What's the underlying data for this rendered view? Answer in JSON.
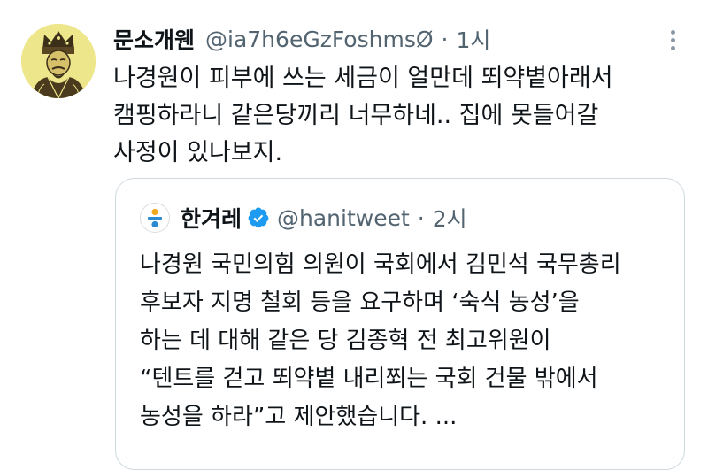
{
  "tweet": {
    "display_name": "문소개웬",
    "handle": "@ia7h6eGzFoshmsØ",
    "separator": "·",
    "time": "1시",
    "more_icon": "more-options-icon",
    "avatar_icon": "king-portrait-avatar",
    "text_lines": [
      "나경원이 피부에 쓰는 세금이 얼만데 뙤약볕아래서",
      "캠핑하라니 같은당끼리 너무하네.. 집에 못들어갈",
      "사정이 있나보지."
    ]
  },
  "quote": {
    "display_name": "한겨레",
    "handle": "@hanitweet",
    "separator": "·",
    "time": "2시",
    "verified_icon": "verified-badge-icon",
    "verified_color": "#1d9bf0",
    "logo_icon": "hankyoreh-logo-icon",
    "text_lines": [
      "나경원 국민의힘 의원이 국회에서 김민석 국무총리",
      "후보자 지명 철회 등을 요구하며 ‘숙식 농성’을",
      "하는 데 대해 같은 당 김종혁 전 최고위원이",
      "“텐트를 걷고 뙤약볕 내리쬐는 국회 건물 밖에서",
      "농성을 하라”고 제안했습니다. ..."
    ]
  },
  "colors": {
    "text_primary": "#0f1419",
    "text_secondary": "#536471",
    "border": "#cfd9de",
    "accent_blue": "#1d9bf0"
  }
}
